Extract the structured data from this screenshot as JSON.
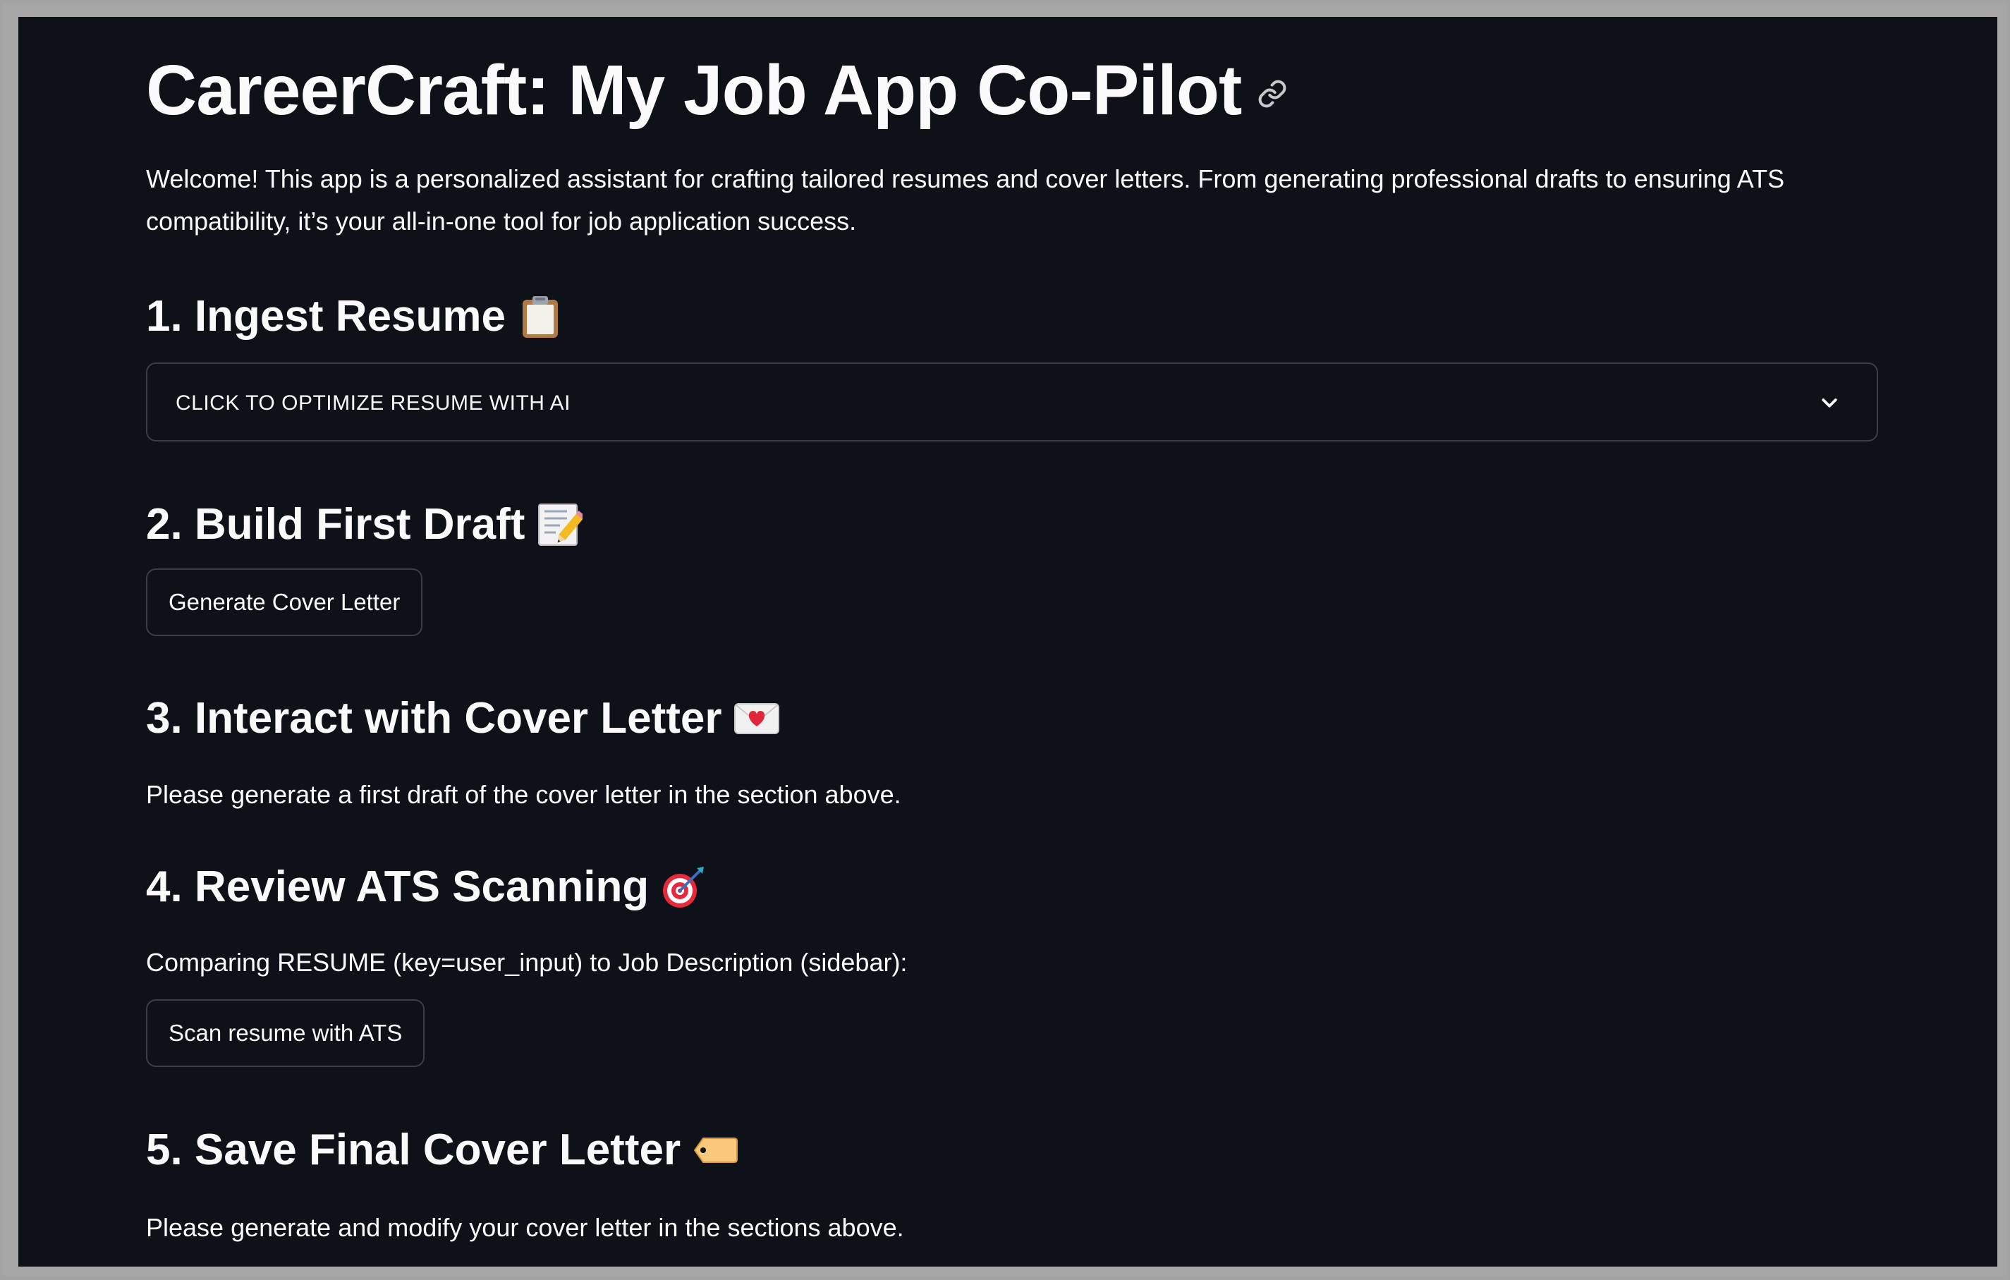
{
  "app": {
    "title": "CareerCraft: My Job App Co-Pilot",
    "intro": "Welcome! This app is a personalized assistant for crafting tailored resumes and cover letters. From generating professional drafts to ensuring ATS compatibility, it’s your all-in-one tool for job application success."
  },
  "sections": [
    {
      "heading": "1. Ingest Resume",
      "icon": "clipboard-icon",
      "expander_label": "CLICK TO OPTIMIZE RESUME WITH AI",
      "expanded": false
    },
    {
      "heading": "2. Build First Draft",
      "icon": "memo-icon",
      "button_label": "Generate Cover Letter"
    },
    {
      "heading": "3. Interact with Cover Letter",
      "icon": "love-letter-icon",
      "message": "Please generate a first draft of the cover letter in the section above."
    },
    {
      "heading": "4. Review ATS Scanning",
      "icon": "direct-hit-icon",
      "message": "Comparing RESUME (key=user_input) to Job Description (sidebar):",
      "button_label": "Scan resume with ATS"
    },
    {
      "heading": "5. Save Final Cover Letter",
      "icon": "label-tag-icon",
      "message": "Please generate and modify your cover letter in the sections above."
    }
  ],
  "colors": {
    "background": "#0e1117",
    "text": "#fafafa",
    "border": "#3b3e47",
    "frame": "#a6a6a6"
  }
}
